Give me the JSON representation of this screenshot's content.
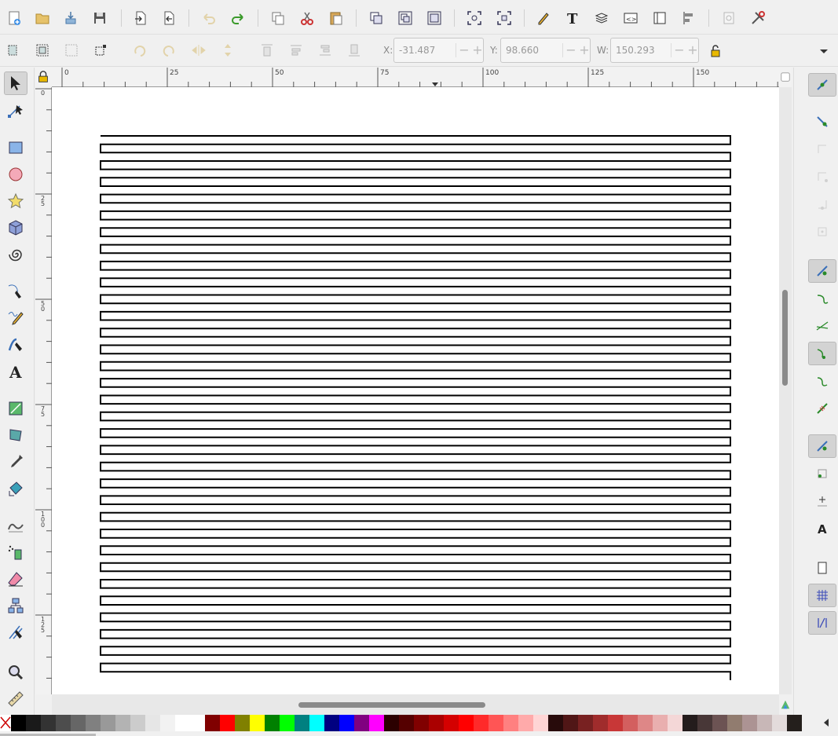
{
  "coords": {
    "x_label": "X:",
    "x_value": "-31.487",
    "y_label": "Y:",
    "y_value": "98.660",
    "w_label": "W:",
    "w_value": "150.293"
  },
  "ruler": {
    "top_labels": [
      "0",
      "25",
      "50",
      "75",
      "100",
      "125",
      "150"
    ],
    "left_labels": [
      "0",
      "25",
      "50",
      "75",
      "100",
      "125"
    ]
  },
  "drawing": {
    "loops": 32,
    "stroke_color": "#000000"
  },
  "toolbar_commands": [
    "new-document-icon",
    "open-document-icon",
    "import-icon",
    "save-icon",
    "export-icon",
    "print-icon",
    "undo-icon",
    "redo-icon",
    "duplicate-icon",
    "cut-icon",
    "paste-icon",
    "group-icon",
    "ungroup-icon",
    "clone-icon",
    "zoom-selection-icon",
    "zoom-drawing-icon",
    "xml-editor-icon",
    "text-tool-icon",
    "layers-icon",
    "fill-stroke-icon",
    "document-properties-icon",
    "align-icon",
    "preferences-icon",
    "tools-icon"
  ],
  "tools": [
    "selector-icon",
    "node-icon",
    "rectangle-icon",
    "ellipse-icon",
    "star-icon",
    "3d-box-icon",
    "spiral-icon",
    "pen-icon",
    "pencil-icon",
    "calligraphy-icon",
    "text-icon",
    "gradient-icon",
    "mesh-icon",
    "dropper-icon",
    "paint-bucket-icon",
    "tweak-icon",
    "spray-icon",
    "eraser-icon",
    "connector-icon",
    "measure-icon",
    "zoom-icon",
    "ruler-icon"
  ],
  "palette": [
    "#000000",
    "#1a1a1a",
    "#333333",
    "#4d4d4d",
    "#666666",
    "#808080",
    "#999999",
    "#b3b3b3",
    "#cccccc",
    "#e6e6e6",
    "#f2f2f2",
    "#ffffff",
    "#ffffff",
    "#800000",
    "#ff0000",
    "#808000",
    "#ffff00",
    "#008000",
    "#00ff00",
    "#008080",
    "#00ffff",
    "#000080",
    "#0000ff",
    "#800080",
    "#ff00ff",
    "#2b0000",
    "#550000",
    "#800000",
    "#aa0000",
    "#d40000",
    "#ff0000",
    "#ff2a2a",
    "#ff5555",
    "#ff8080",
    "#ffaaaa",
    "#ffd5d5",
    "#280b0b",
    "#501616",
    "#782121",
    "#a02c2c",
    "#c83737",
    "#d35f5f",
    "#de8787",
    "#e9afaf",
    "#f4d7d7",
    "#241c1c",
    "#483737",
    "#6c5353",
    "#917c6f",
    "#ac9393",
    "#c8b7b7",
    "#e3dbdb",
    "#241f1c"
  ]
}
